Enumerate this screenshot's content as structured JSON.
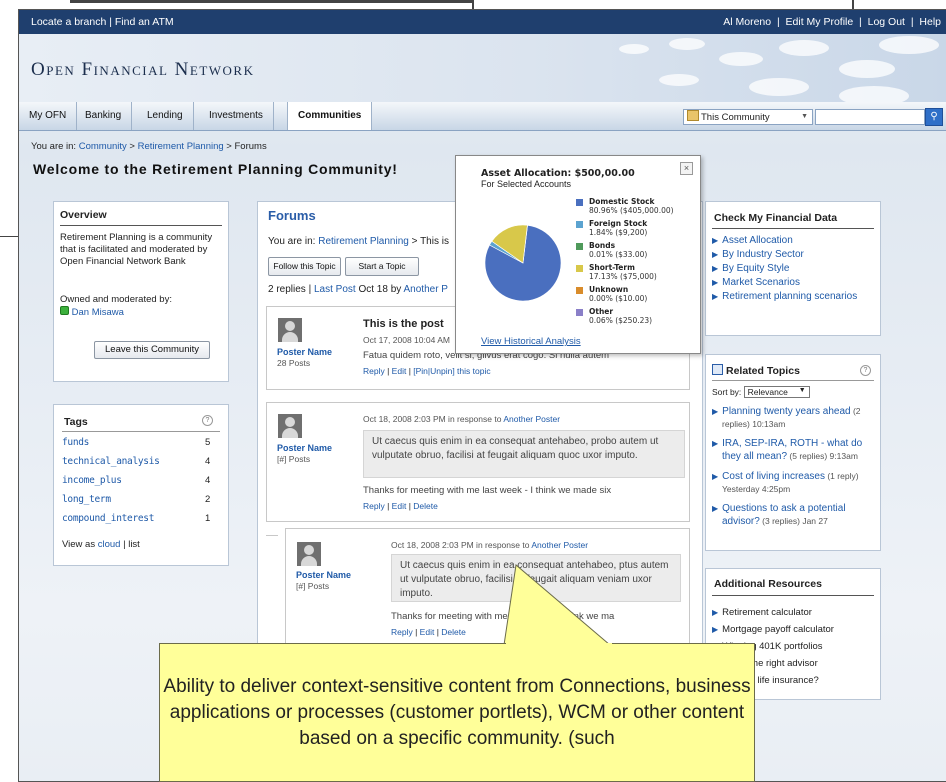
{
  "top_left_links": [
    "Locate a branch",
    "Find an ATM"
  ],
  "top_right_links": [
    "Al Moreno",
    "Edit My Profile",
    "Log Out",
    "Help"
  ],
  "brand": "Open Financial Network",
  "tabs": [
    "My OFN",
    "Banking",
    "Lending",
    "Investments",
    "Communities"
  ],
  "search": {
    "scope": "This Community"
  },
  "breadcrumb": {
    "prefix": "You are in:",
    "items": [
      "Community",
      "Retirement Planning",
      "Forums"
    ]
  },
  "page_title": "Welcome to the Retirement Planning Community!",
  "overview": {
    "title": "Overview",
    "text": "Retirement Planning is a community that is facilitated and moderated by Open Financial Network Bank",
    "owner_label": "Owned and moderated by:",
    "owner": "Dan Misawa",
    "leave_button": "Leave this Community"
  },
  "tags": {
    "title": "Tags",
    "items": [
      {
        "name": "funds",
        "count": "5"
      },
      {
        "name": "technical_analysis",
        "count": "4"
      },
      {
        "name": "income_plus",
        "count": "4"
      },
      {
        "name": "long_term",
        "count": "2"
      },
      {
        "name": "compound_interest",
        "count": "1"
      }
    ],
    "view_as": "View as",
    "cloud": "cloud",
    "list": "list"
  },
  "forums": {
    "title": "Forums",
    "you_are_in": "You are in:",
    "crumb_link": "Retirement Planning",
    "crumb_rest": "> This is",
    "follow_button": "Follow this Topic",
    "start_button": "Start a Topic",
    "replies": "2 replies",
    "last_post": "Last Post",
    "last_post_date": "Oct 18 by",
    "last_post_author": "Another P",
    "posts": [
      {
        "title": "This is the post",
        "meta": "Oct 17, 2008 10:04 AM",
        "body": "Fatua quidem roto, velit si, gilvus erat cogo. Si nulla autem",
        "author": "Poster Name",
        "count": "28 Posts",
        "actions": [
          "Reply",
          "Edit",
          "[Pin|Unpin] this topic"
        ]
      },
      {
        "meta": "Oct 18, 2008 2:03 PM in response to",
        "meta_link": "Another Poster",
        "quote": "Ut caecus quis enim in ea consequat antehabeo, probo autem ut vulputate obruo, facilisi at feugait aliquam quoc uxor imputo.",
        "body": "Thanks for meeting with me last week - I think we made six",
        "author": "Poster Name",
        "count": "[#] Posts",
        "actions": [
          "Reply",
          "Edit",
          "Delete"
        ]
      },
      {
        "meta": "Oct 18, 2008 2:03 PM in response to",
        "meta_link": "Another Poster",
        "quote": "Ut caecus quis enim in ea consequat antehabeo, ptus autem ut vulputate obruo, facilisi at feugait aliquam veniam uxor imputo.",
        "body": "Thanks for meeting with me last week - I think we ma",
        "author": "Poster Name",
        "count": "[#] Posts",
        "actions": [
          "Reply",
          "Edit",
          "Delete"
        ]
      }
    ]
  },
  "popup": {
    "title": "Asset Allocation: $500,00.00",
    "subtitle": "For Selected Accounts",
    "link": "View Historical Analysis",
    "close": "×"
  },
  "chart_data": {
    "type": "pie",
    "title": "Asset Allocation: $500,00.00",
    "subtitle": "For Selected Accounts",
    "series": [
      {
        "name": "Domestic Stock",
        "percent": "80.96%",
        "amount": "($405,000.00)",
        "value": 80.96,
        "color": "#4a6fbf"
      },
      {
        "name": "Foreign Stock",
        "percent": "1.84%",
        "amount": "($9,200)",
        "value": 1.84,
        "color": "#5ba3d0"
      },
      {
        "name": "Bonds",
        "percent": "0.01%",
        "amount": "($33.00)",
        "value": 0.01,
        "color": "#4f9a5b"
      },
      {
        "name": "Short-Term",
        "percent": "17.13%",
        "amount": "($75,000)",
        "value": 17.13,
        "color": "#d8c84a"
      },
      {
        "name": "Unknown",
        "percent": "0.00%",
        "amount": "($10.00)",
        "value": 0.0,
        "color": "#d98c2b"
      },
      {
        "name": "Other",
        "percent": "0.06%",
        "amount": "($250.23)",
        "value": 0.06,
        "color": "#8a7fc8"
      }
    ]
  },
  "financial": {
    "title": "Check My Financial Data",
    "items": [
      "Asset Allocation",
      "By Industry Sector",
      "By Equity Style",
      "Market Scenarios",
      "Retirement planning scenarios"
    ]
  },
  "related": {
    "title": "Related Topics",
    "sort_label": "Sort by:",
    "sort_value": "Relevance",
    "items": [
      {
        "title": "Planning twenty years ahead",
        "meta": "(2 replies) 10:13am"
      },
      {
        "title": "IRA, SEP-IRA, ROTH - what do they all mean?",
        "meta": "(5 replies) 9:13am"
      },
      {
        "title": "Cost of living increases",
        "meta": "(1 reply) Yesterday 4:25pm"
      },
      {
        "title": "Questions to ask a potential advisor?",
        "meta": "(3 replies) Jan 27"
      }
    ]
  },
  "resources": {
    "title": "Additional Resources",
    "items": [
      "Retirement calculator",
      "Mortgage payoff calculator",
      "Winning 401K portfolios",
      "inding the right advisor",
      "w much life insurance?"
    ]
  },
  "callout": {
    "text": "Ability to deliver context-sensitive content from Connections, business applications or processes (customer portlets), WCM or other content based on a specific community. (such"
  }
}
